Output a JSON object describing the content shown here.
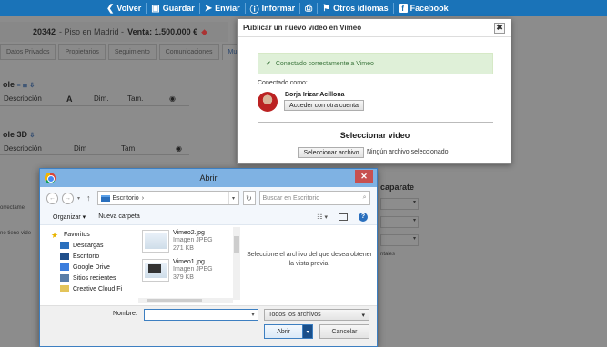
{
  "toolbar": {
    "items": [
      {
        "icon": "chevron-left-icon",
        "label": "Volver"
      },
      {
        "icon": "save-icon",
        "label": "Guardar"
      },
      {
        "icon": "send-icon",
        "label": "Enviar"
      },
      {
        "icon": "info-icon",
        "label": "Informar"
      },
      {
        "icon": "print-icon",
        "label": ""
      },
      {
        "icon": "flag-icon",
        "label": "Otros idiomas"
      },
      {
        "icon": "facebook-icon",
        "label": "Facebook"
      }
    ],
    "colors": {
      "background": "#1a73b8",
      "text": "#ffffff"
    }
  },
  "background_page": {
    "property_code": "20342",
    "property_title": "- Piso en Madrid -",
    "property_price": "Venta: 1.500.000 €",
    "tabs": [
      "Datos Privados",
      "Propietarios",
      "Seguimiento",
      "Comunicaciones",
      "Mu"
    ],
    "section1_title": "ole",
    "section1_columns": [
      "Descripción",
      "A",
      "Dim.",
      "Tam.",
      ""
    ],
    "section2_title": "ole 3D",
    "section2_columns": [
      "Descripción",
      "Dim",
      "Tam",
      ""
    ],
    "right_title": "caparate",
    "right_note": "ntales",
    "side_texts": [
      "orrectame",
      "no tiene vide"
    ]
  },
  "vimeo_modal": {
    "title": "Publicar un nuevo video en Vimeo",
    "close_label": "✖",
    "success_message": "Conectado correctamente a Vimeo",
    "connected_label": "Conectado como:",
    "user_name": "Borja Irizar Acillona",
    "switch_account_label": "Acceder con otra cuenta",
    "select_video_title": "Seleccionar video",
    "select_file_label": "Seleccionar archivo",
    "no_file_text": "Ningún archivo seleccionado",
    "colors": {
      "success_bg": "#dff0d8",
      "success_text": "#3c763d"
    }
  },
  "open_dialog": {
    "title": "Abrir",
    "close_label": "✕",
    "address": "Escritorio",
    "address_sep": "›",
    "search_placeholder": "Buscar en Escritorio",
    "organize_label": "Organizar ▾",
    "new_folder_label": "Nueva carpeta",
    "tree": [
      {
        "label": "Favoritos",
        "icon": "star-icon",
        "sub": false
      },
      {
        "label": "Descargas",
        "icon": "downloads-folder-icon",
        "sub": true
      },
      {
        "label": "Escritorio",
        "icon": "desktop-icon",
        "sub": true
      },
      {
        "label": "Google Drive",
        "icon": "google-drive-icon",
        "sub": true
      },
      {
        "label": "Sitios recientes",
        "icon": "recent-places-icon",
        "sub": true
      },
      {
        "label": "Creative Cloud Fi",
        "icon": "creative-cloud-icon",
        "sub": true
      }
    ],
    "files": [
      {
        "name": "Vimeo2.jpg",
        "type": "Imagen JPEG",
        "size": "271 KB"
      },
      {
        "name": "Vimeo1.jpg",
        "type": "Imagen JPEG",
        "size": "379 KB"
      }
    ],
    "preview_text": "Seleccione el archivo del que desea obtener la vista previa.",
    "name_label": "Nombre:",
    "name_value": "",
    "filter_value": "Todos los archivos",
    "open_label": "Abrir",
    "cancel_label": "Cancelar",
    "colors": {
      "titlebar": "#7fb2e3",
      "close": "#c75050"
    }
  }
}
